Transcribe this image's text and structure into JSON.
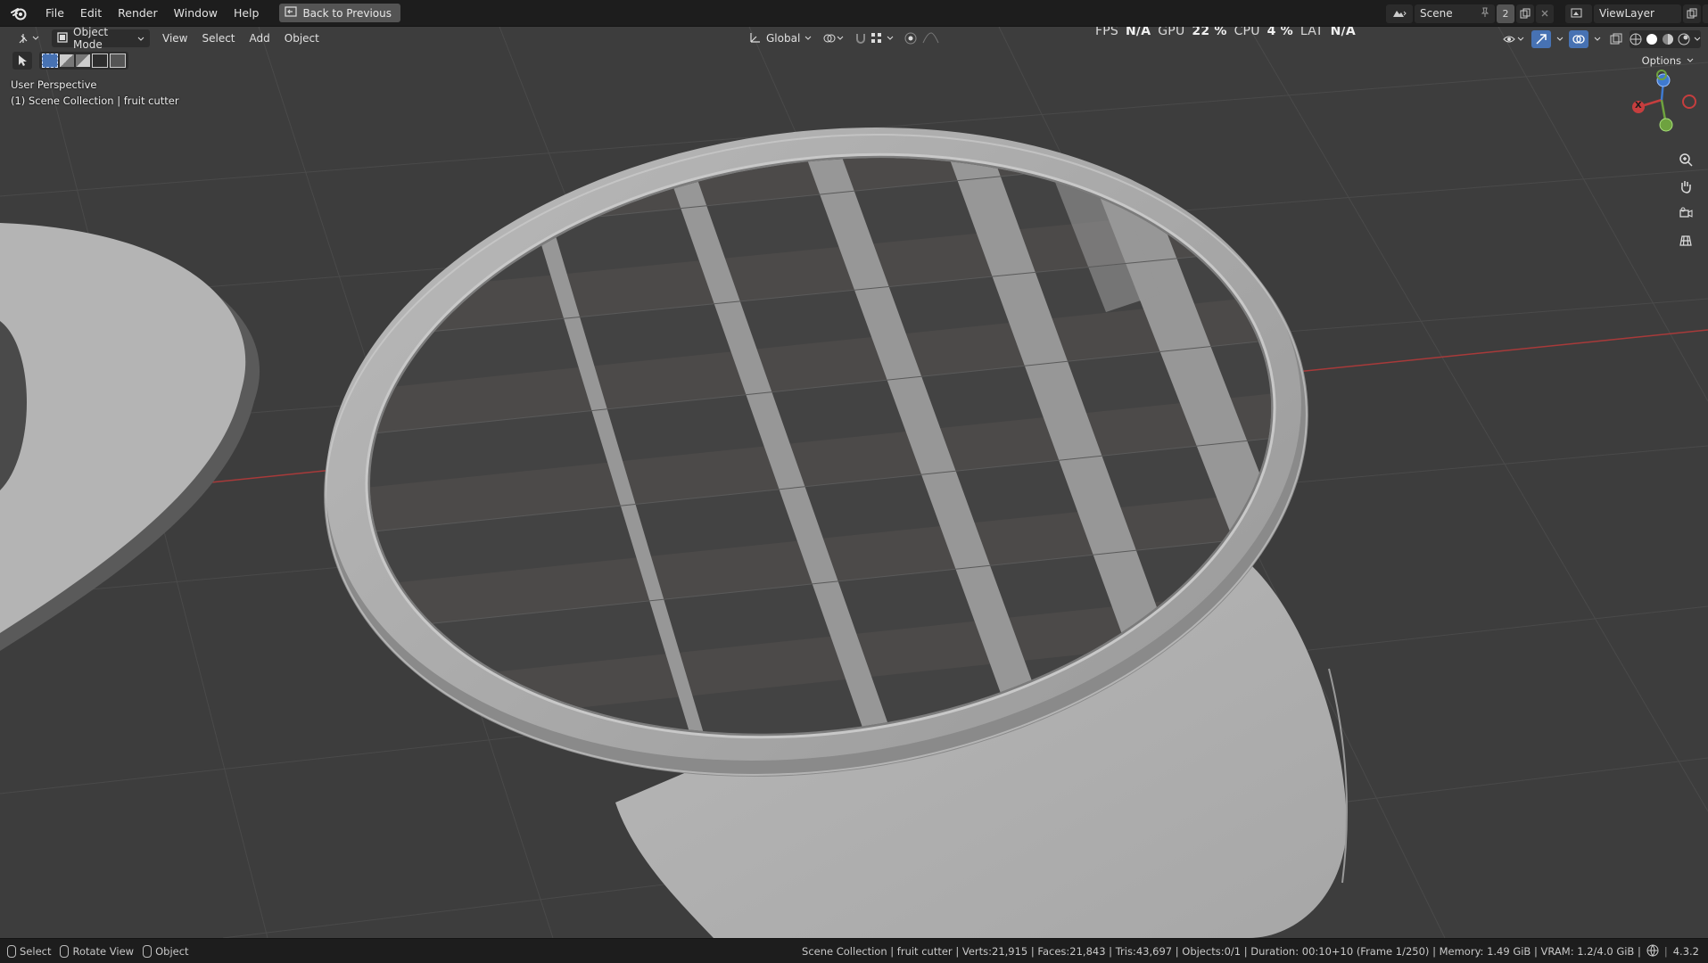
{
  "topbar": {
    "menus": [
      "File",
      "Edit",
      "Render",
      "Window",
      "Help"
    ],
    "back_button": "Back to Previous",
    "scene_name": "Scene",
    "scene_users": "2",
    "view_layer": "ViewLayer"
  },
  "viewport_header": {
    "mode": "Object Mode",
    "menus": [
      "View",
      "Select",
      "Add",
      "Object"
    ],
    "transform_orientation": "Global",
    "options_label": "Options"
  },
  "overlay": {
    "perspective": "User Perspective",
    "collection_line": "(1) Scene Collection | fruit cutter"
  },
  "stats": {
    "fps_label": "FPS",
    "fps_value": "N/A",
    "gpu_label": "GPU",
    "gpu_value": "22 %",
    "cpu_label": "CPU",
    "cpu_value": "4 %",
    "lat_label": "LAT",
    "lat_value": "N/A"
  },
  "gizmo": {
    "x_label": "X"
  },
  "statusbar": {
    "select": "Select",
    "rotate": "Rotate View",
    "object": "Object",
    "info": "Scene Collection | fruit cutter | Verts:21,915 | Faces:21,843 | Tris:43,697 | Objects:0/1 | Duration: 00:10+10 (Frame 1/250) | Memory: 1.49 GiB | VRAM: 1.2/4.0 GiB |",
    "version": "4.3.2"
  },
  "colors": {
    "accent": "#4772b3",
    "axis_x": "#c63e3e",
    "axis_y": "#6ea23f",
    "axis_z": "#3f7ad0",
    "viewport_bg": "#3d3d3d"
  },
  "icons": [
    "blender-logo-icon",
    "back-icon",
    "scene-icon",
    "pin-icon",
    "new-scene-icon",
    "close-icon",
    "viewlayer-icon",
    "editor-type-icon",
    "object-mode-icon",
    "orientation-icon",
    "pivot-icon",
    "snap-icon",
    "proportional-icon",
    "visibility-icon",
    "gizmo-icon",
    "overlay-icon",
    "xray-icon",
    "shading-icons",
    "zoom-icon",
    "pan-icon",
    "camera-icon",
    "ortho-grid-icon",
    "mouse-icon",
    "network-icon"
  ]
}
